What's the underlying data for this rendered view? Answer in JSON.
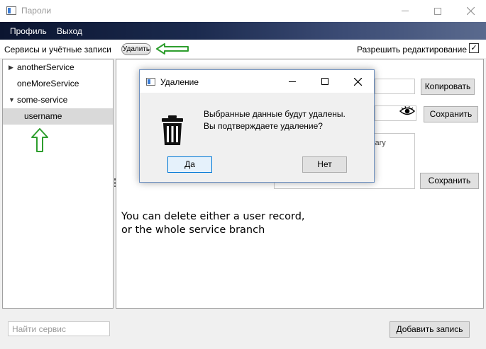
{
  "window": {
    "title": "Пароли"
  },
  "menu": {
    "items": [
      "Профиль",
      "Выход"
    ]
  },
  "toolbar": {
    "section_label": "Сервисы и учётные записи",
    "delete_label": "Удалить",
    "allow_edit_label": "Разрешить редактирование",
    "allow_edit_checked": true,
    "check_glyph": "✓"
  },
  "tree": {
    "items": [
      {
        "label": "anotherService",
        "toggle": "▶"
      },
      {
        "label": "oneMoreService",
        "toggle": ""
      },
      {
        "label": "some-service",
        "toggle": "▼"
      },
      {
        "label": "username",
        "toggle": ""
      }
    ],
    "selected_index": 3
  },
  "details": {
    "copy_label": "Копировать",
    "save_label_1": "Сохранить",
    "save_label_2": "Сохранить",
    "notes_visible_text": "sary"
  },
  "hint": {
    "line1": "You can delete either a user record,",
    "line2": "or the whole service branch"
  },
  "bottom": {
    "search_placeholder": "Найти сервис",
    "add_label": "Добавить запись"
  },
  "dialog": {
    "title": "Удаление",
    "message_line1": "Выбранные данные будут удалены.",
    "message_line2": "Вы подтверждаете удаление?",
    "yes_label": "Да",
    "no_label": "Нет",
    "icon": "trash-icon"
  },
  "colors": {
    "menubar_dark": "#0b1530",
    "annotation_arrow": "#2e9e2e",
    "focus_blue": "#0078d7"
  }
}
